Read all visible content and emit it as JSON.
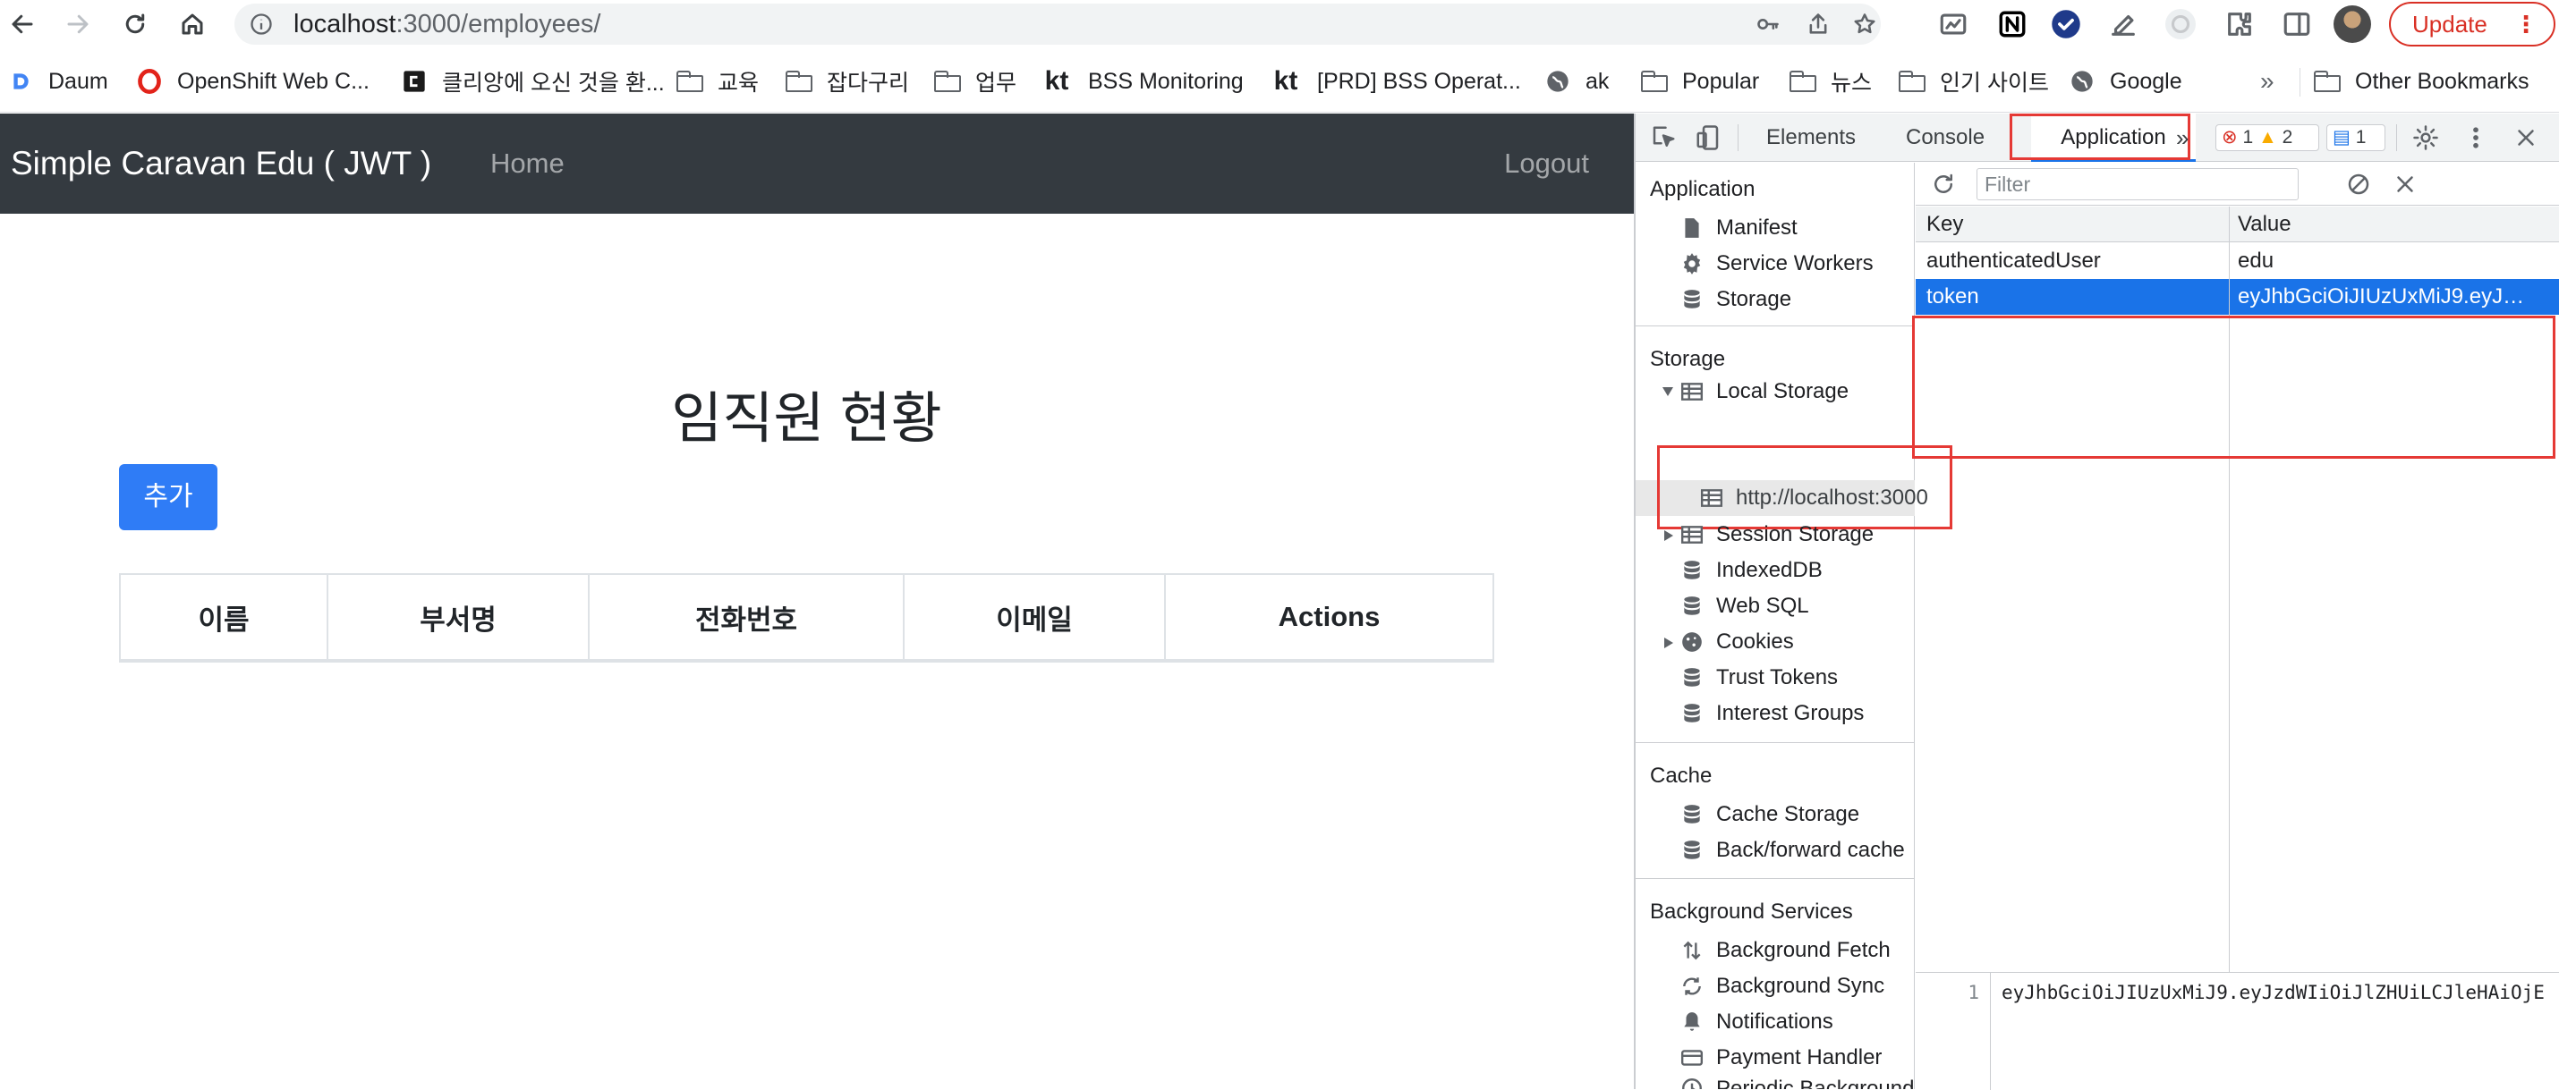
{
  "browser": {
    "url_host": "localhost",
    "url_path": ":3000/employees/",
    "update_label": "Update",
    "update_menu": "⋮",
    "bookmarks_overflow": "»",
    "bookmarks": [
      {
        "label": "Daum",
        "icon": "daum-icon"
      },
      {
        "label": "OpenShift Web C...",
        "icon": "opera-icon"
      },
      {
        "label": "클리앙에 오신 것을 환...",
        "icon": "clien-icon"
      },
      {
        "label": "교육",
        "icon": "folder-icon"
      },
      {
        "label": "잡다구리",
        "icon": "folder-icon"
      },
      {
        "label": "업무",
        "icon": "folder-icon"
      },
      {
        "label": "BSS Monitoring",
        "icon": "kt-icon"
      },
      {
        "label": "[PRD] BSS Operat...",
        "icon": "kt-icon"
      },
      {
        "label": "ak",
        "icon": "globe-icon"
      },
      {
        "label": "Popular",
        "icon": "folder-icon"
      },
      {
        "label": "뉴스",
        "icon": "folder-icon"
      },
      {
        "label": "인기 사이트",
        "icon": "folder-icon"
      },
      {
        "label": "Google",
        "icon": "globe-icon"
      }
    ],
    "other_bookmarks": "Other Bookmarks",
    "kt_logo_text": "kt"
  },
  "app": {
    "brand": "Simple Caravan Edu ( JWT )",
    "nav_home": "Home",
    "nav_logout": "Logout",
    "page_title": "임직원 현황",
    "add_button": "추가",
    "table_headers": [
      "이름",
      "부서명",
      "전화번호",
      "이메일",
      "Actions"
    ]
  },
  "devtools": {
    "tabs": {
      "elements": "Elements",
      "console": "Console",
      "application": "Application",
      "more": "»"
    },
    "errors": "1",
    "warnings": "2",
    "messages": "1",
    "sidebar": {
      "application_section": "Application",
      "application_items": [
        "Manifest",
        "Service Workers",
        "Storage"
      ],
      "storage_section": "Storage",
      "local_storage": "Local Storage",
      "local_storage_origin": "http://localhost:3000",
      "storage_items": [
        "Session Storage",
        "IndexedDB",
        "Web SQL",
        "Cookies",
        "Trust Tokens",
        "Interest Groups"
      ],
      "cache_section": "Cache",
      "cache_items": [
        "Cache Storage",
        "Back/forward cache"
      ],
      "bg_section": "Background Services",
      "bg_items": [
        "Background Fetch",
        "Background Sync",
        "Notifications",
        "Payment Handler",
        "Periodic Background Sync"
      ]
    },
    "filter_placeholder": "Filter",
    "kv_headers": {
      "key": "Key",
      "value": "Value"
    },
    "kv_rows": [
      {
        "key": "authenticatedUser",
        "value": "edu"
      },
      {
        "key": "token",
        "value": "eyJhbGciOiJIUzUxMiJ9.eyJ…"
      }
    ],
    "preview_line_number": "1",
    "preview_text": "eyJhbGciOiJIUzUxMiJ9.eyJzdWIiOiJlZHUiLCJleHAiOjE"
  },
  "colors": {
    "app_nav_bg": "#343a40",
    "primary_button": "#2f7cf6",
    "selected_row": "#1a73e8",
    "highlight_box": "#e53935",
    "update_red": "#d93025"
  }
}
